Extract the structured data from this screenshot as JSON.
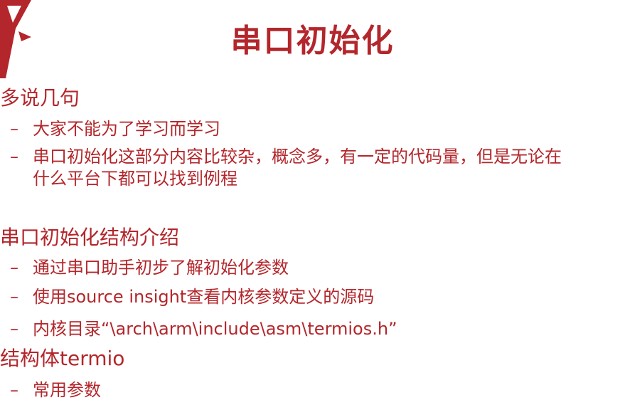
{
  "colors": {
    "accent": "#b3262b",
    "background": "#ffffff"
  },
  "logo": {
    "icon": "red-mark-logo-icon"
  },
  "title": "串口初始化",
  "sections": [
    {
      "heading": "多说几句",
      "items": [
        {
          "dash": "–",
          "text": "大家不能为了学习而学习"
        },
        {
          "dash": "–",
          "text": "串口初始化这部分内容比较杂，概念多，有一定的代码量，但是无论在",
          "continuation": "什么平台下都可以找到例程"
        }
      ]
    },
    {
      "heading": "串口初始化结构介绍",
      "items": [
        {
          "dash": "–",
          "text": "通过串口助手初步了解初始化参数"
        },
        {
          "dash": "–",
          "text": "使用source insight查看内核参数定义的源码"
        },
        {
          "dash": "–",
          "text": "内核目录“\\arch\\arm\\include\\asm\\termios.h”"
        }
      ]
    },
    {
      "heading": "结构体termio",
      "items": [
        {
          "dash": "–",
          "text": "常用参数"
        }
      ]
    }
  ]
}
